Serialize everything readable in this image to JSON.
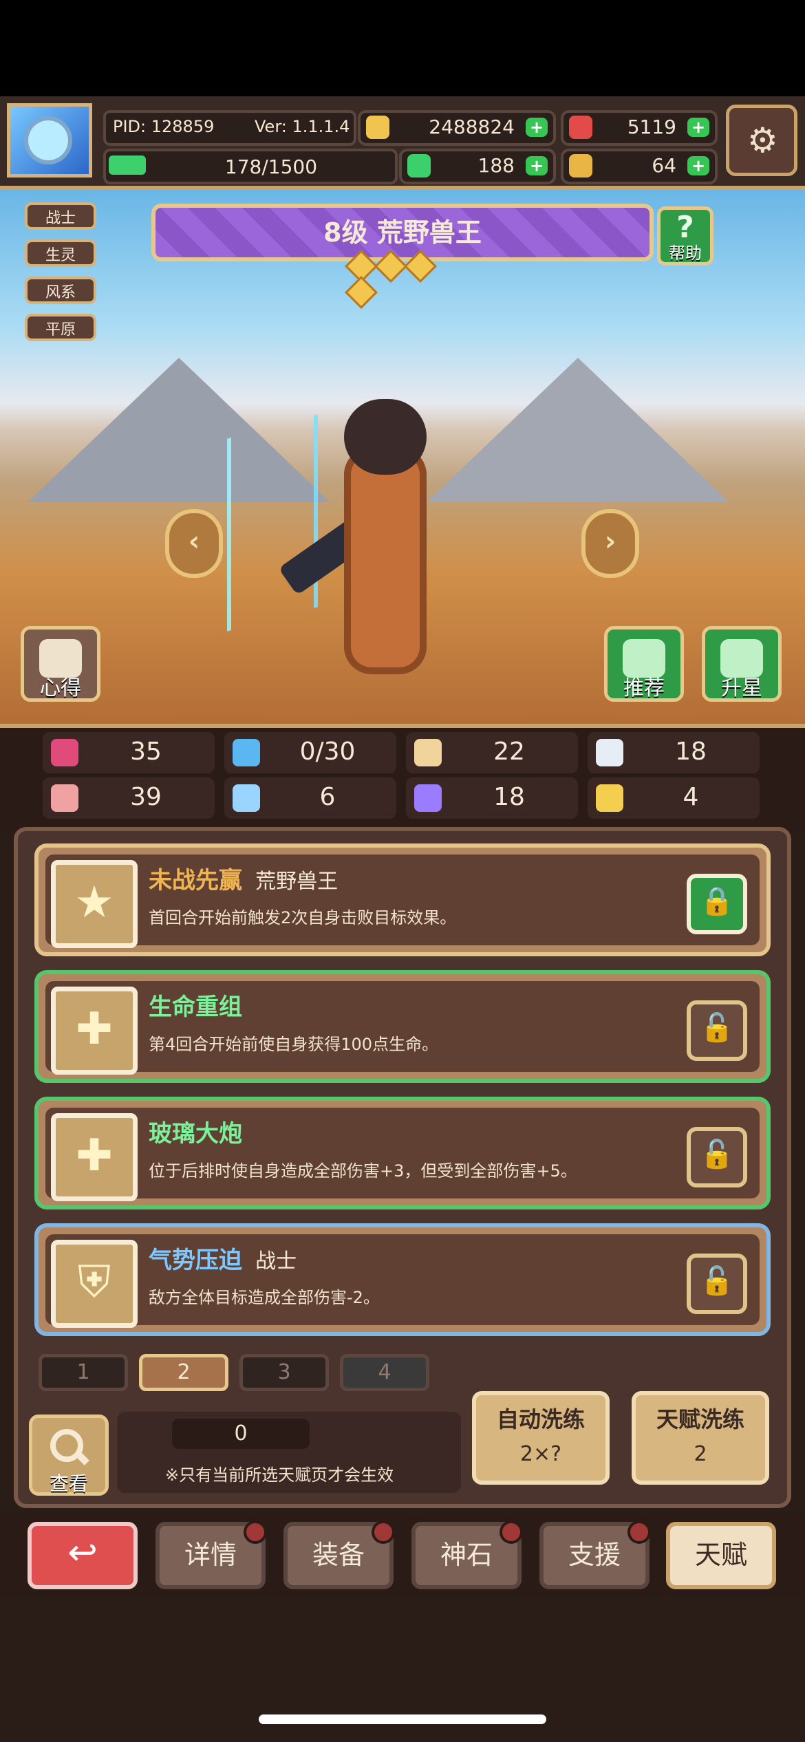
{
  "top": {
    "pid": "PID: 128859",
    "ver": "Ver: 1.1.1.4",
    "stamina": "178/1500",
    "gold": "2488824",
    "gem": "5119",
    "clover": "188",
    "key": "64"
  },
  "tags": [
    "战士",
    "生灵",
    "风系",
    "平原"
  ],
  "title": "8级  荒野兽王",
  "help_label": "帮助",
  "side_buttons": {
    "left": "心得",
    "recommend": "推荐",
    "upgrade": "升星"
  },
  "stats": {
    "row1": [
      "35",
      "0/30",
      "22",
      "18"
    ],
    "row2": [
      "39",
      "6",
      "18",
      "4"
    ]
  },
  "talents": [
    {
      "name": "未战先赢",
      "sub": "荒野兽王",
      "desc": "首回合开始前触发2次自身击败目标效果。"
    },
    {
      "name": "生命重组",
      "sub": "",
      "desc": "第4回合开始前使自身获得100点生命。"
    },
    {
      "name": "玻璃大炮",
      "sub": "",
      "desc": "位于后排时使自身造成全部伤害+3，但受到全部伤害+5。"
    },
    {
      "name": "气势压迫",
      "sub": "战士",
      "desc": "敌方全体目标造成全部伤害-2。"
    }
  ],
  "pages": [
    "1",
    "2",
    "3",
    "4"
  ],
  "controls": {
    "view_label": "查看",
    "count": "0",
    "note": "※只有当前所选天赋页才会生效",
    "auto_wash_label": "自动洗练",
    "auto_wash_cost": "2×?",
    "talent_wash_label": "天赋洗练",
    "talent_wash_cost": "2"
  },
  "nav": {
    "back_icon": "↩",
    "items": [
      "详情",
      "装备",
      "神石",
      "支援",
      "天赋"
    ]
  },
  "icons": {
    "settings": "gear-icon",
    "help": "question-icon",
    "lock": "lock-icon",
    "unlock": "unlock-icon"
  }
}
